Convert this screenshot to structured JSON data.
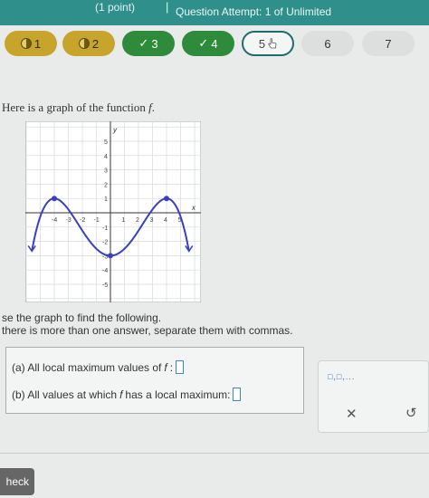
{
  "header": {
    "breadcrumb": "(1 point)",
    "separator": "|",
    "attempt": "Question Attempt: 1 of Unlimited"
  },
  "question_nav": [
    {
      "label": "1",
      "state": "partial"
    },
    {
      "label": "2",
      "state": "partial"
    },
    {
      "label": "3",
      "state": "done"
    },
    {
      "label": "4",
      "state": "done"
    },
    {
      "label": "5",
      "state": "current"
    },
    {
      "label": "6",
      "state": "todo"
    },
    {
      "label": "7",
      "state": "todo"
    }
  ],
  "icons": {
    "check": "✓",
    "close": "✕",
    "undo": "↺"
  },
  "prompt": {
    "text": "Here is a graph of the function ",
    "function": "f",
    "period": "."
  },
  "graph": {
    "x_label": "x",
    "y_label": "y",
    "x_ticks": [
      "-4",
      "-3",
      "-2",
      "-1",
      "1",
      "2",
      "3",
      "4",
      "5"
    ],
    "y_ticks": [
      "5",
      "4",
      "3",
      "2",
      "1",
      "-1",
      "-2",
      "-3",
      "-4",
      "-5"
    ],
    "curve_color": "#3b3ec4",
    "local_max_points": [
      [
        -4,
        1
      ],
      [
        4,
        1
      ]
    ],
    "local_min_point": [
      0,
      -3
    ]
  },
  "instructions": {
    "line1": "se the graph to find the following.",
    "line2": " there is more than one answer, separate them with commas."
  },
  "answers": {
    "a_label": "(a) All local maximum values of ",
    "a_func": "f",
    "a_colon": ":",
    "b_label": "(b) All values at which ",
    "b_func": "f",
    "b_rest": " has a local maximum:"
  },
  "tools": {
    "symbol_label": "□,□,..."
  },
  "footer": {
    "check_label": "heck"
  }
}
